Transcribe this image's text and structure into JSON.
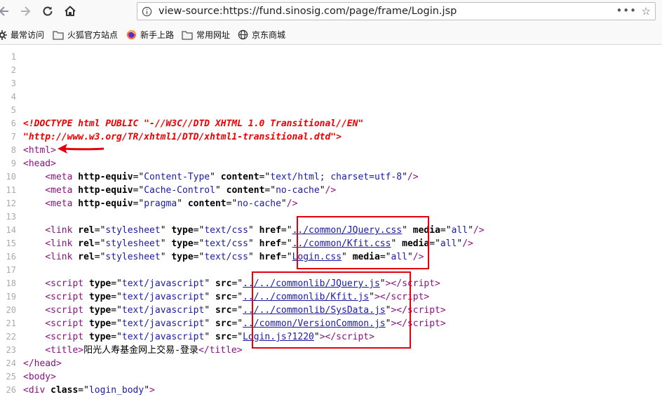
{
  "browser": {
    "url": "view-source:https://fund.sinosig.com/page/frame/Login.jsp",
    "more": "•••",
    "star": "☆",
    "bookmarks": [
      {
        "label": "最常访问",
        "icon": "gear-icon"
      },
      {
        "label": "火狐官方站点",
        "icon": "folder-icon"
      },
      {
        "label": "新手上路",
        "icon": "firefox-icon"
      },
      {
        "label": "常用网址",
        "icon": "folder-icon"
      },
      {
        "label": "京东商城",
        "icon": "globe-icon"
      }
    ]
  },
  "source": {
    "line_numbers": [
      "1",
      "2",
      "3",
      "4",
      "5",
      "6",
      "7",
      "8",
      "9",
      "10",
      "11",
      "12",
      "13",
      "14",
      "15",
      "16",
      "17",
      "18",
      "19",
      "20",
      "21",
      "22",
      "23",
      "24",
      "25",
      "26"
    ],
    "doctype_1": "<!DOCTYPE html PUBLIC \"-//W3C//DTD XHTML 1.0 Transitional//EN\"",
    "doctype_2": "\"http://www.w3.org/TR/xhtml1/DTD/xhtml1-transitional.dtd\">",
    "html_open": "<html>",
    "head_open": "<head>",
    "meta1_val1": "Content-Type",
    "meta1_val2": "text/html; charset=utf-8",
    "meta2_val1": "Cache-Control",
    "meta2_val2": "no-cache",
    "meta3_val1": "pragma",
    "meta3_val2": "no-cache",
    "links": [
      {
        "href": "../common/JQuery.css",
        "media": "all"
      },
      {
        "href": "../common/Kfit.css",
        "media": "all"
      },
      {
        "href": "Login.css",
        "media": "all"
      }
    ],
    "rel_val": "stylesheet",
    "type_css": "text/css",
    "type_js": "text/javascript",
    "scripts": [
      "../../commonlib/JQuery.js",
      "../../commonlib/Kfit.js",
      "../../commonlib/SysData.js",
      "../common/VersionCommon.js",
      "Login.js?1220"
    ],
    "title_text": "阳光人寿基金网上交易-登录",
    "head_close": "</head>",
    "body_open": "<body>",
    "div_class": "login_body"
  }
}
